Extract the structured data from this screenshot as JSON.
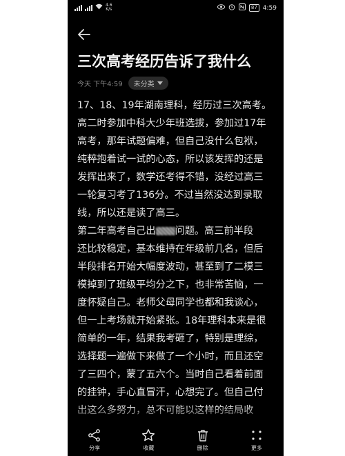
{
  "statusbar": {
    "network_speed_value": "4.6",
    "network_speed_unit": "K/s",
    "battery_level": "87",
    "time": "4:59"
  },
  "note": {
    "title": "三次高考经历告诉了我什么",
    "meta_time": "今天 下午4:59",
    "category": "未分类",
    "body_lines": [
      "17、18、19年湖南理科，经历过三次高考。",
      "高二时参加中科大少年班选拔，参加过17年",
      "高考，那年试题偏难，但自己没什么包袱，",
      "纯粹抱着试一试的心态，所以该发挥的还是",
      "发挥出来了，数学还考得不错，没经过高三",
      "一轮复习考了136分。不过当然没达到录取",
      "线，所以还是读了高三。",
      "",
      "还比较稳定，基本维持在年级前几名，但后",
      "半段排名开始大幅度波动，甚至到了二模三",
      "模掉到了班级平均分之下，也非常苦恼，一",
      "度怀疑自己。老师父母同学也都和我谈心，",
      "但一上考场就开始紧张。18年理科本来是很",
      "简单的一年，结果我考砸了，特别是理综，",
      "选择题一遍做下来做了一个小时，而且还空",
      "了三四个，蒙了五六个。当时自己看着前面",
      "的挂钟，手心直冒汗，心想完了。但自己付",
      "出这么多努力，总不可能以这样的结局收"
    ],
    "line8_prefix": "第二年高考自己出",
    "line8_suffix": "问题。高三前半段"
  },
  "toolbar": {
    "share": "分享",
    "favorite": "收藏",
    "delete": "删除",
    "more": "更多"
  }
}
